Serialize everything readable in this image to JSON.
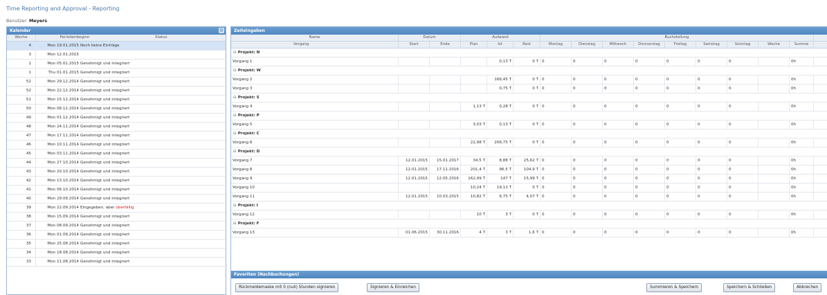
{
  "app": {
    "title": "Time Reporting and Approval - Reporting"
  },
  "user": {
    "label": "Benutzer:",
    "name": "Meyers"
  },
  "calendar": {
    "title": "Kalender",
    "tool_icon": "gear-icon",
    "columns": {
      "week": "Woche",
      "period": "Periodenbeginn",
      "status": "Status"
    },
    "rows": [
      {
        "week": "4",
        "period": "Mon 19.01.2015",
        "status": "Noch keine Einträge",
        "selected": true
      },
      {
        "week": "3",
        "period": "Mon 12.01.2015",
        "status": ""
      },
      {
        "week": "2",
        "period": "Mon 05.01.2015",
        "status": "Genehmigt und integriert"
      },
      {
        "week": "1",
        "period": "Thu 01.01.2015",
        "status": "Genehmigt und integriert"
      },
      {
        "week": "52",
        "period": "Mon 29.12.2014",
        "status": "Genehmigt und integriert"
      },
      {
        "week": "52",
        "period": "Mon 22.12.2014",
        "status": "Genehmigt und integriert"
      },
      {
        "week": "51",
        "period": "Mon 15.12.2014",
        "status": "Genehmigt und integriert"
      },
      {
        "week": "50",
        "period": "Mon 08.12.2014",
        "status": "Genehmigt und integriert"
      },
      {
        "week": "49",
        "period": "Mon 01.12.2014",
        "status": "Genehmigt und integriert"
      },
      {
        "week": "48",
        "period": "Mon 24.11.2014",
        "status": "Genehmigt und integriert"
      },
      {
        "week": "47",
        "period": "Mon 17.11.2014",
        "status": "Genehmigt und integriert"
      },
      {
        "week": "46",
        "period": "Mon 10.11.2014",
        "status": "Genehmigt und integriert"
      },
      {
        "week": "45",
        "period": "Mon 03.11.2014",
        "status": "Genehmigt und integriert"
      },
      {
        "week": "44",
        "period": "Mon 27.10.2014",
        "status": "Genehmigt und integriert"
      },
      {
        "week": "43",
        "period": "Mon 20.10.2014",
        "status": "Genehmigt und integriert"
      },
      {
        "week": "42",
        "period": "Mon 13.10.2014",
        "status": "Genehmigt und integriert"
      },
      {
        "week": "41",
        "period": "Mon 06.10.2014",
        "status": "Genehmigt und integriert"
      },
      {
        "week": "40",
        "period": "Mon 29.09.2014",
        "status": "Genehmigt und integriert"
      },
      {
        "week": "39",
        "period": "Mon 22.09.2014",
        "status": "Eingegeben, aber",
        "status_extra": "überfällig"
      },
      {
        "week": "38",
        "period": "Mon 15.09.2014",
        "status": "Genehmigt und integriert"
      },
      {
        "week": "37",
        "period": "Mon 08.09.2014",
        "status": "Genehmigt und integriert"
      },
      {
        "week": "36",
        "period": "Mon 01.09.2014",
        "status": "Genehmigt und integriert"
      },
      {
        "week": "35",
        "period": "Mon 25.08.2014",
        "status": "Genehmigt und integriert"
      },
      {
        "week": "34",
        "period": "Mon 18.08.2014",
        "status": "Genehmigt und integriert"
      },
      {
        "week": "33",
        "period": "Mon 11.08.2014",
        "status": "Genehmigt und integriert"
      }
    ]
  },
  "grid": {
    "title": "Zeiteingaben",
    "group_headers": [
      "Name",
      "Datum",
      "Aufwand",
      "Buchstellung"
    ],
    "col_headers": [
      "Vorgang",
      "Start",
      "Ende",
      "Plan",
      "Ist",
      "Rest",
      "Montag",
      "Dienstag",
      "Mittwoch",
      "Donnerstag",
      "Freitag",
      "Samstag",
      "Sonntag",
      "Woche",
      "Summe"
    ],
    "items": [
      {
        "type": "project",
        "name": "Projekt: N"
      },
      {
        "type": "task",
        "name": "Vorgang 1",
        "start": "",
        "end": "",
        "plan": "",
        "ist": "0,13 T",
        "rest": "0 T",
        "days": [
          "0",
          "0",
          "0",
          "0",
          "0",
          "0",
          "0"
        ],
        "week": "",
        "sum": "0h"
      },
      {
        "type": "project",
        "name": "Projekt: W"
      },
      {
        "type": "task",
        "name": "Vorgang 2",
        "start": "",
        "end": "",
        "plan": "",
        "ist": "166,45 T",
        "rest": "0 T",
        "days": [
          "0",
          "0",
          "0",
          "0",
          "0",
          "0",
          "0"
        ],
        "week": "",
        "sum": "0h"
      },
      {
        "type": "task",
        "name": "Vorgang 3",
        "start": "",
        "end": "",
        "plan": "",
        "ist": "0,75 T",
        "rest": "0 T",
        "days": [
          "0",
          "0",
          "0",
          "0",
          "0",
          "0",
          "0"
        ],
        "week": "",
        "sum": "0h"
      },
      {
        "type": "project",
        "name": "Projekt: S"
      },
      {
        "type": "task",
        "name": "Vorgang 4",
        "start": "",
        "end": "",
        "plan": "1,13 T",
        "ist": "0,28 T",
        "rest": "0 T",
        "days": [
          "0",
          "0",
          "0",
          "0",
          "0",
          "0",
          "0"
        ],
        "week": "",
        "sum": "0h"
      },
      {
        "type": "project",
        "name": "Projekt: P"
      },
      {
        "type": "task",
        "name": "Vorgang 5",
        "start": "",
        "end": "",
        "plan": "3,03 T",
        "ist": "0,13 T",
        "rest": "0 T",
        "days": [
          "0",
          "0",
          "0",
          "0",
          "0",
          "0",
          "0"
        ],
        "week": "",
        "sum": "0h"
      },
      {
        "type": "project",
        "name": "Projekt: C"
      },
      {
        "type": "task",
        "name": "Vorgang 6",
        "start": "",
        "end": "",
        "plan": "22,98 T",
        "ist": "206,75 T",
        "rest": "0 T",
        "days": [
          "0",
          "0",
          "0",
          "0",
          "0",
          "0",
          "0"
        ],
        "week": "",
        "sum": "0h"
      },
      {
        "type": "project",
        "name": "Projekt: D"
      },
      {
        "type": "task",
        "name": "Vorgang 7",
        "start": "12.01.2015",
        "end": "15.01.2017",
        "plan": "34,5 T",
        "ist": "8,88 T",
        "rest": "25,62 T",
        "days": [
          "0",
          "0",
          "0",
          "0",
          "0",
          "0",
          "0"
        ],
        "week": "",
        "sum": "0h"
      },
      {
        "type": "task",
        "name": "Vorgang 8",
        "start": "12.01.2015",
        "end": "17.11.2016",
        "plan": "201,4 T",
        "ist": "96,5 T",
        "rest": "104,9 T",
        "days": [
          "0",
          "0",
          "0",
          "0",
          "0",
          "0",
          "0"
        ],
        "week": "",
        "sum": "0h"
      },
      {
        "type": "task",
        "name": "Vorgang 9",
        "start": "12.01.2015",
        "end": "12.05.2016",
        "plan": "162,99 T",
        "ist": "147 T",
        "rest": "15,99 T",
        "days": [
          "0",
          "0",
          "0",
          "0",
          "0",
          "0",
          "0"
        ],
        "week": "",
        "sum": "0h"
      },
      {
        "type": "task",
        "name": "Vorgang 10",
        "start": "",
        "end": "",
        "plan": "10,24 T",
        "ist": "19,13 T",
        "rest": "0 T",
        "days": [
          "0",
          "0",
          "0",
          "0",
          "0",
          "0",
          "0"
        ],
        "week": "",
        "sum": "0h"
      },
      {
        "type": "task",
        "name": "Vorgang 11",
        "start": "12.01.2015",
        "end": "10.03.2015",
        "plan": "10,82 T",
        "ist": "6,75 T",
        "rest": "4,07 T",
        "days": [
          "0",
          "0",
          "0",
          "0",
          "0",
          "0",
          "0"
        ],
        "week": "",
        "sum": "0h"
      },
      {
        "type": "project",
        "name": "Projekt: I"
      },
      {
        "type": "task",
        "name": "Vorgang 12",
        "start": "",
        "end": "",
        "plan": "10 T",
        "ist": "3 T",
        "rest": "0 T",
        "days": [
          "0",
          "0",
          "0",
          "0",
          "0",
          "0",
          "0"
        ],
        "week": "",
        "sum": "0h"
      },
      {
        "type": "project",
        "name": "Projekt: F"
      },
      {
        "type": "task",
        "name": "Vorgang 13",
        "start": "01.06.2015",
        "end": "30.11.2016",
        "plan": "4 T",
        "ist": "3 T",
        "rest": "1,6 T",
        "days": [
          "0",
          "0",
          "0",
          "0",
          "0",
          "0",
          "0"
        ],
        "week": "",
        "sum": "0h"
      }
    ]
  },
  "favorites": {
    "title": "Favoriten (Nachbuchungen)"
  },
  "buttons": {
    "sign_zero": "Rückmeldemaske mit 0 (null) Stunden signieren",
    "sign_submit": "Signieren & Einreichen",
    "sum_save": "Summieren & Speichern",
    "save_close": "Speichern & Schließen",
    "cancel": "Abbrechen"
  },
  "colors": {
    "header": "#5a90c8",
    "link": "#4a77aa",
    "selected_row": "#d4e4f6",
    "overdue": "#cc2222"
  }
}
